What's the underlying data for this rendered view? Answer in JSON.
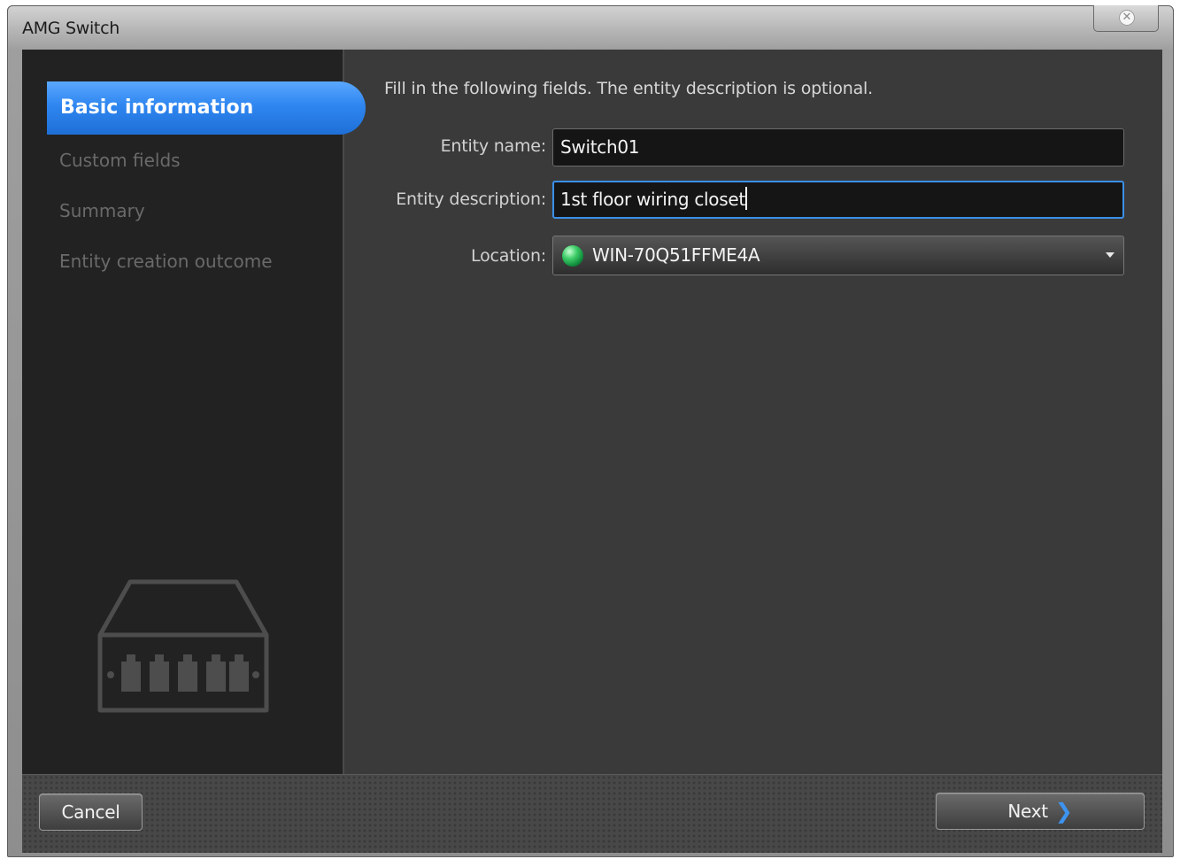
{
  "window": {
    "title": "AMG Switch",
    "close_icon": "close-icon"
  },
  "steps": [
    {
      "label": "Basic information",
      "active": true
    },
    {
      "label": "Custom fields",
      "active": false
    },
    {
      "label": "Summary",
      "active": false
    },
    {
      "label": "Entity creation outcome",
      "active": false
    }
  ],
  "sidebar": {
    "graphic_icon": "network-switch-icon"
  },
  "form": {
    "instructions": "Fill in the following fields. The entity description is optional.",
    "entity_name": {
      "label": "Entity name:",
      "value": "Switch01"
    },
    "entity_description": {
      "label": "Entity description:",
      "value": "1st floor wiring closet"
    },
    "location": {
      "label": "Location:",
      "value": "WIN-70Q51FFME4A",
      "icon": "globe-icon"
    }
  },
  "footer": {
    "cancel_label": "Cancel",
    "next_label": "Next"
  },
  "colors": {
    "accent": "#2f86f0",
    "background": "#3a3a3a",
    "sidebar": "#222222"
  }
}
